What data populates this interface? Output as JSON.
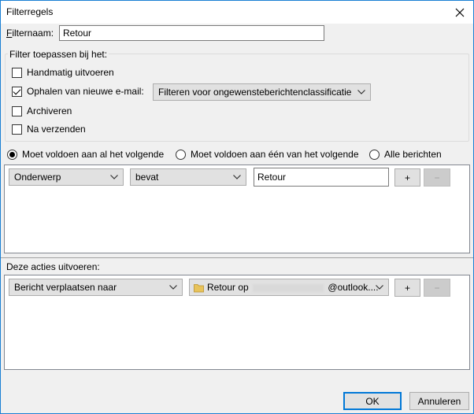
{
  "window": {
    "title": "Filterregels",
    "close_glyph": "✕"
  },
  "filter_name": {
    "label": "Filternaam:",
    "value": "Retour"
  },
  "apply_group": {
    "label": "Filter toepassen bij het:",
    "manual": {
      "label": "Handmatig uitvoeren",
      "checked": false
    },
    "fetch_new": {
      "label": "Ophalen van nieuwe e-mail:",
      "checked": true,
      "select_value": "Filteren voor ongewensteberichtenclassificatie"
    },
    "archive": {
      "label": "Archiveren",
      "checked": false
    },
    "after_send": {
      "label": "Na verzenden",
      "checked": false
    }
  },
  "match": {
    "all": {
      "label": "Moet voldoen aan al het volgende",
      "checked": true
    },
    "any": {
      "label": "Moet voldoen aan één van het volgende",
      "checked": false
    },
    "every": {
      "label": "Alle berichten",
      "checked": false
    }
  },
  "condition_row": {
    "field": "Onderwerp",
    "operator": "bevat",
    "value": "Retour",
    "add_label": "+",
    "remove_label": "−"
  },
  "actions": {
    "label": "Deze acties uitvoeren:",
    "action": "Bericht verplaatsen naar",
    "folder_prefix": "Retour op",
    "folder_suffix": "@outlook....",
    "folder_icon": "folder-icon",
    "add_label": "+",
    "remove_label": "−"
  },
  "footer": {
    "ok": "OK",
    "cancel": "Annuleren"
  },
  "colors": {
    "accent": "#0078d7",
    "window_border": "#1a7fd4",
    "folder": "#e8c35a"
  }
}
